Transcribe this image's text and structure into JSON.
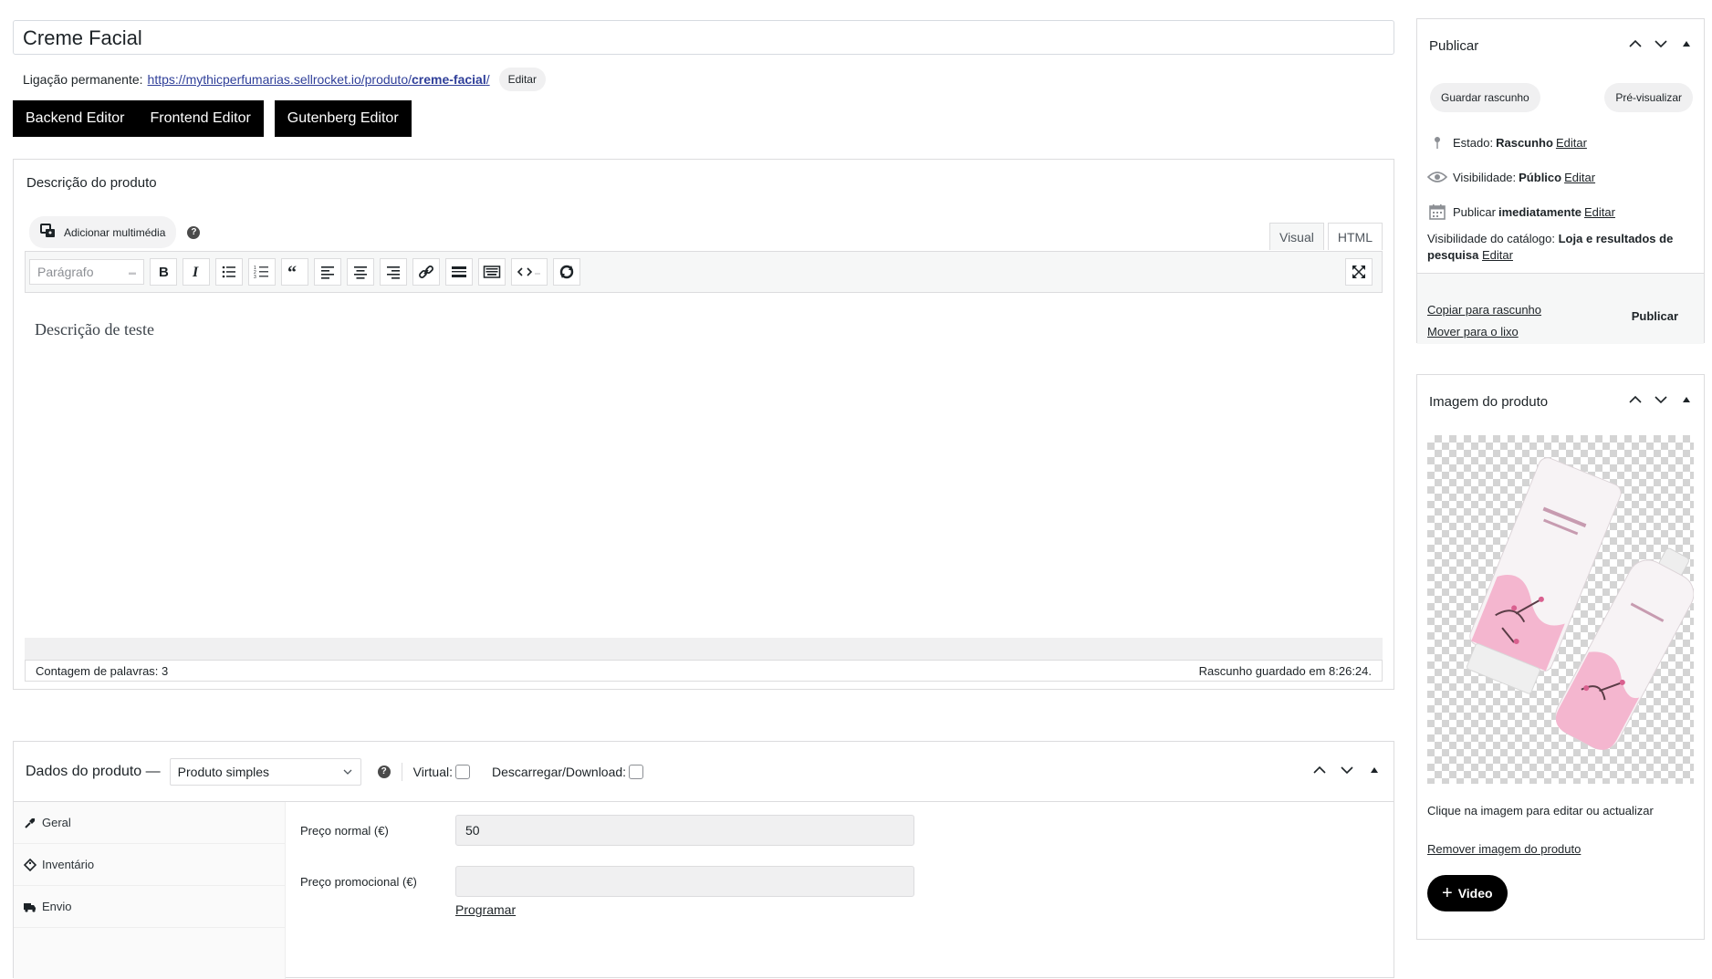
{
  "post": {
    "title": "Creme Facial",
    "permalink_label": "Ligação permanente:",
    "permalink_base": "https://mythicperfumarias.sellrocket.io/produto/",
    "permalink_slug": "creme-facial",
    "permalink_end": "/",
    "permalink_edit": "Editar"
  },
  "editors": {
    "backend": "Backend Editor",
    "frontend": "Frontend Editor",
    "gutenberg": "Gutenberg Editor"
  },
  "description": {
    "title": "Descrição do produto",
    "add_media": "Adicionar multimédia",
    "help": "?",
    "tab_visual": "Visual",
    "tab_html": "HTML",
    "format": "Parágrafo",
    "content": "Descrição de teste",
    "word_count": "Contagem de palavras: 3",
    "draft_saved": "Rascunho guardado em 8:26:24."
  },
  "product_data": {
    "title": "Dados do produto —",
    "type": "Produto simples",
    "help": "?",
    "virtual_label": "Virtual:",
    "download_label": "Descarregar/Download:",
    "tabs": [
      {
        "label": "Geral",
        "icon": "wrench-icon"
      },
      {
        "label": "Inventário",
        "icon": "tag-icon"
      },
      {
        "label": "Envio",
        "icon": "truck-icon"
      }
    ],
    "regular_price_label": "Preço normal (€)",
    "regular_price": "50",
    "sale_price_label": "Preço promocional (€)",
    "sale_price": "",
    "schedule": "Programar"
  },
  "publish": {
    "title": "Publicar",
    "save_draft": "Guardar rascunho",
    "preview": "Pré-visualizar",
    "status_label": "Estado:",
    "status_value": "Rascunho",
    "visibility_label": "Visibilidade:",
    "visibility_value": "Público",
    "publish_label": "Publicar",
    "publish_value": "imediatamente",
    "edit": "Editar",
    "catalog_label": "Visibilidade do catálogo:",
    "catalog_value": "Loja e resultados de pesquisa",
    "copy_draft": "Copiar para rascunho",
    "trash": "Mover para o lixo",
    "publish_button": "Publicar"
  },
  "product_image": {
    "title": "Imagem do produto",
    "note": "Clique na imagem para editar ou actualizar",
    "remove": "Remover imagem do produto",
    "video_button": "Video"
  },
  "colors": {
    "accent_black": "#000000",
    "link": "#2f3f99",
    "border": "#dcdcde",
    "tube_pink": "#f4b6cf"
  }
}
